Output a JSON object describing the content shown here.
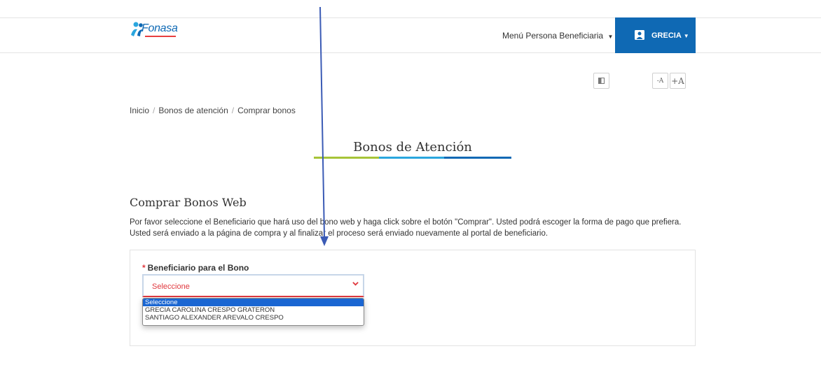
{
  "header": {
    "logo_text": "Fonasa",
    "menu_label": "Menú Persona Beneficiaria",
    "user_name": "GRECIA"
  },
  "toolbar": {
    "contrast_icon": "contrast-icon",
    "font_decrease": "-A",
    "font_increase": "+A"
  },
  "breadcrumb": {
    "items": [
      "Inicio",
      "Bonos de atención",
      "Comprar bonos"
    ]
  },
  "page_title": "Bonos de Atención",
  "section": {
    "title": "Comprar Bonos Web",
    "description": "Por favor seleccione el Beneficiario que hará uso del bono web y haga click sobre el botón \"Comprar\". Usted podrá escoger la forma de pago que prefiera. Usted será enviado a la página de compra y al finalizar el proceso será enviado nuevamente al portal de beneficiario."
  },
  "form": {
    "required_mark": "*",
    "beneficiary_label": "Beneficiario para el Bono",
    "select_value": "Seleccione",
    "options": [
      "Seleccione",
      "GRECIA CAROLINA CRESPO GRATERON",
      "SANTIAGO ALEXANDER AREVALO CRESPO"
    ]
  },
  "colors": {
    "brand_blue": "#0f69b4",
    "required_red": "#e0383e",
    "bar_green": "#a6c438",
    "bar_light_blue": "#2aa6de",
    "bar_dark_blue": "#0f69b4",
    "annotation_arrow": "#3b5bb5"
  }
}
